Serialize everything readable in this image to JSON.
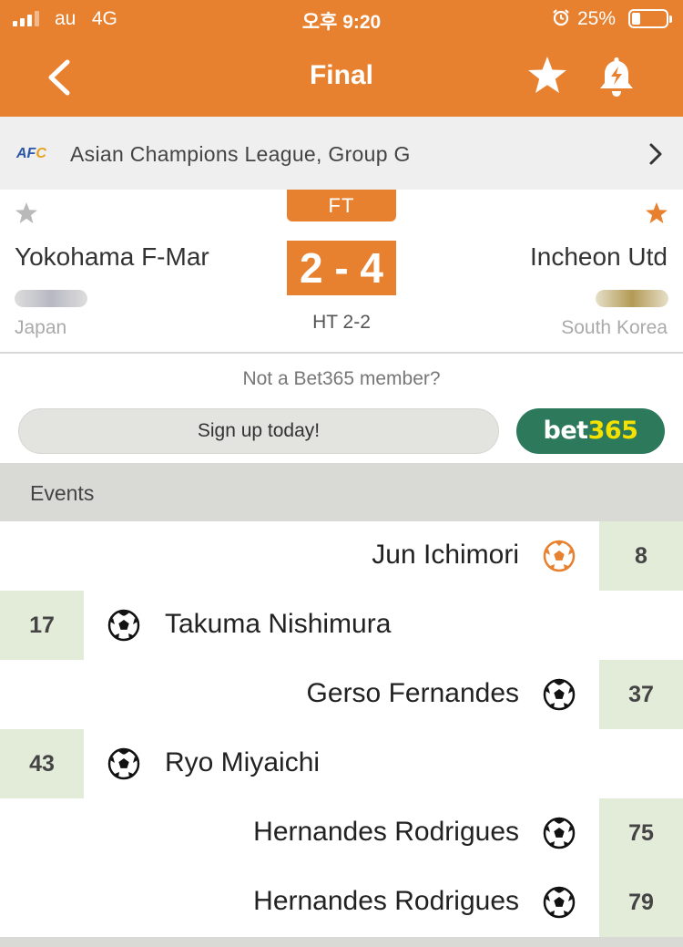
{
  "status_bar": {
    "carrier": "au",
    "network": "4G",
    "time": "오후 9:20",
    "battery_pct": "25%",
    "battery_level": 0.25
  },
  "header": {
    "title": "Final",
    "back_icon": "chevron-left-icon",
    "favorite_icon": "star-icon",
    "alert_icon": "bell-icon"
  },
  "league": {
    "logo_text": "AFC",
    "name": "Asian Champions League, Group G"
  },
  "match": {
    "status": "FT",
    "score": "2 - 4",
    "halftime": "HT 2-2",
    "home": {
      "name": "Yokohama F-Mar",
      "country": "Japan",
      "favorited": false
    },
    "away": {
      "name": "Incheon Utd",
      "country": "South Korea",
      "favorited": true
    }
  },
  "promo": {
    "question": "Not a Bet365 member?",
    "signup_label": "Sign up today!",
    "brand_part1": "bet",
    "brand_part2": "365"
  },
  "events": {
    "title": "Events",
    "items": [
      {
        "side": "away",
        "player": "Jun Ichimori",
        "minute": "8",
        "type": "own-goal"
      },
      {
        "side": "home",
        "player": "Takuma Nishimura",
        "minute": "17",
        "type": "goal"
      },
      {
        "side": "away",
        "player": "Gerso Fernandes",
        "minute": "37",
        "type": "goal"
      },
      {
        "side": "home",
        "player": "Ryo Miyaichi",
        "minute": "43",
        "type": "goal"
      },
      {
        "side": "away",
        "player": "Hernandes Rodrigues",
        "minute": "75",
        "type": "goal"
      },
      {
        "side": "away",
        "player": "Hernandes Rodrigues",
        "minute": "79",
        "type": "goal"
      }
    ]
  },
  "colors": {
    "accent": "#e8812f",
    "minute_bg": "#e3ebd9",
    "bet365_green": "#2c7a5b",
    "bet365_yellow": "#f5e100",
    "section_bg": "#d9d9d6"
  }
}
